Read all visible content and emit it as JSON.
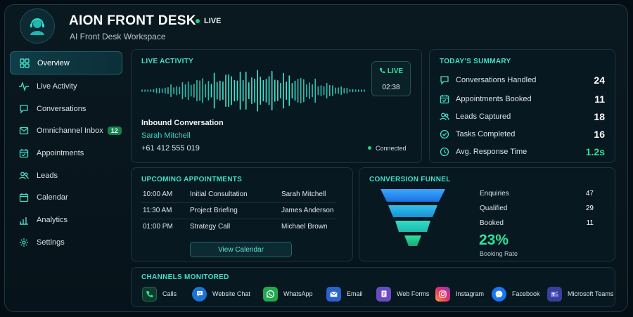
{
  "header": {
    "title": "AION FRONT DESK",
    "status": "LIVE",
    "subtitle": "AI Front Desk Workspace",
    "avatar_icon": "headset-agent-icon"
  },
  "sidebar": {
    "items": [
      {
        "label": "Overview",
        "icon": "grid-icon",
        "active": true
      },
      {
        "label": "Live Activity",
        "icon": "pulse-icon"
      },
      {
        "label": "Conversations",
        "icon": "chat-bubble-icon"
      },
      {
        "label": "Omnichannel Inbox",
        "icon": "inbox-icon",
        "badge": "12"
      },
      {
        "label": "Appointments",
        "icon": "calendar-check-icon"
      },
      {
        "label": "Leads",
        "icon": "users-icon"
      },
      {
        "label": "Calendar",
        "icon": "calendar-icon"
      },
      {
        "label": "Analytics",
        "icon": "bar-chart-icon"
      },
      {
        "label": "Settings",
        "icon": "gear-icon"
      }
    ]
  },
  "live_activity": {
    "title": "LIVE ACTIVITY",
    "live_badge": "LIVE",
    "timer": "02:38",
    "conversation_type": "Inbound Conversation",
    "caller_name": "Sarah Mitchell",
    "caller_phone": "+61 412 555 019",
    "connection_status": "Connected"
  },
  "summary": {
    "title": "TODAY'S SUMMARY",
    "rows": [
      {
        "label": "Conversations Handled",
        "value": "24",
        "icon": "chat-bubble-icon"
      },
      {
        "label": "Appointments Booked",
        "value": "11",
        "icon": "calendar-check-icon"
      },
      {
        "label": "Leads Captured",
        "value": "18",
        "icon": "users-icon"
      },
      {
        "label": "Tasks Completed",
        "value": "16",
        "icon": "check-circle-icon"
      },
      {
        "label": "Avg. Response Time",
        "value": "1.2s",
        "icon": "clock-icon"
      }
    ]
  },
  "appointments": {
    "title": "UPCOMING APPOINTMENTS",
    "rows": [
      {
        "time": "10:00 AM",
        "type": "Initial Consultation",
        "name": "Sarah Mitchell"
      },
      {
        "time": "11:30 AM",
        "type": "Project Briefing",
        "name": "James Anderson"
      },
      {
        "time": "01:00 PM",
        "type": "Strategy Call",
        "name": "Michael Brown"
      }
    ],
    "button": "View Calendar"
  },
  "funnel": {
    "title": "CONVERSION FUNNEL",
    "stages": [
      {
        "label": "Enquiries",
        "value": "47"
      },
      {
        "label": "Qualified",
        "value": "29"
      },
      {
        "label": "Booked",
        "value": "11"
      }
    ],
    "rate": "23%",
    "rate_label": "Booking Rate"
  },
  "channels": {
    "title": "CHANNELS MONITORED",
    "items": [
      {
        "label": "Calls",
        "icon": "phone-icon",
        "color": "#1f6f4a"
      },
      {
        "label": "Website Chat",
        "icon": "chat-icon",
        "color": "#1b74d6"
      },
      {
        "label": "WhatsApp",
        "icon": "whatsapp-icon",
        "color": "#1fa84f"
      },
      {
        "label": "Email",
        "icon": "email-icon",
        "color": "#2a63c9"
      },
      {
        "label": "Web Forms",
        "icon": "form-icon",
        "color": "#6a4bc4"
      },
      {
        "label": "Instagram",
        "icon": "instagram-icon",
        "color": "#d6387a"
      },
      {
        "label": "Facebook",
        "icon": "messenger-icon",
        "color": "#1877f2"
      },
      {
        "label": "Microsoft Teams",
        "icon": "teams-icon",
        "color": "#5b5fc7"
      }
    ]
  },
  "colors": {
    "accent": "#3ee0c8",
    "success": "#2de19d",
    "background": "#050d14"
  }
}
